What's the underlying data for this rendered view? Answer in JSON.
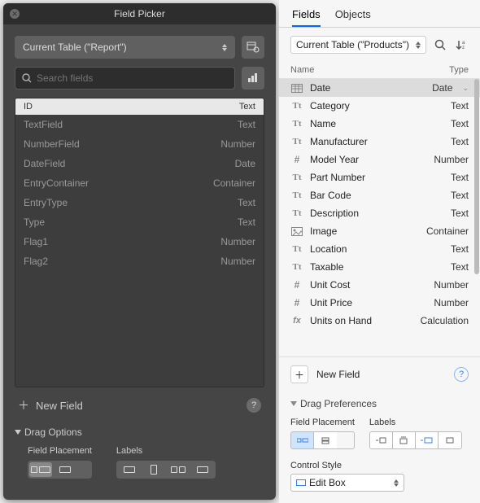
{
  "left": {
    "title": "Field Picker",
    "table_select": "Current Table (\"Report\")",
    "search_placeholder": "Search fields",
    "columns": {
      "name": "ID",
      "type": "Text"
    },
    "fields": [
      {
        "name": "TextField",
        "type": "Text"
      },
      {
        "name": "NumberField",
        "type": "Number"
      },
      {
        "name": "DateField",
        "type": "Date"
      },
      {
        "name": "EntryContainer",
        "type": "Container"
      },
      {
        "name": "EntryType",
        "type": "Text"
      },
      {
        "name": "Type",
        "type": "Text"
      },
      {
        "name": "Flag1",
        "type": "Number"
      },
      {
        "name": "Flag2",
        "type": "Number"
      }
    ],
    "new_field": "New Field",
    "drag_options": "Drag Options",
    "field_placement": "Field Placement",
    "labels": "Labels"
  },
  "right": {
    "tabs": {
      "fields": "Fields",
      "objects": "Objects"
    },
    "table_select": "Current Table (\"Products\")",
    "columns": {
      "name": "Name",
      "type": "Type"
    },
    "fields": [
      {
        "icon": "table",
        "name": "Date",
        "type": "Date",
        "selected": true
      },
      {
        "icon": "Tt",
        "name": "Category",
        "type": "Text"
      },
      {
        "icon": "Tt",
        "name": "Name",
        "type": "Text"
      },
      {
        "icon": "Tt",
        "name": "Manufacturer",
        "type": "Text"
      },
      {
        "icon": "#",
        "name": "Model Year",
        "type": "Number"
      },
      {
        "icon": "Tt",
        "name": "Part Number",
        "type": "Text"
      },
      {
        "icon": "Tt",
        "name": "Bar Code",
        "type": "Text"
      },
      {
        "icon": "Tt",
        "name": "Description",
        "type": "Text"
      },
      {
        "icon": "image",
        "name": "Image",
        "type": "Container"
      },
      {
        "icon": "Tt",
        "name": "Location",
        "type": "Text"
      },
      {
        "icon": "Tt",
        "name": "Taxable",
        "type": "Text"
      },
      {
        "icon": "#",
        "name": "Unit Cost",
        "type": "Number"
      },
      {
        "icon": "#",
        "name": "Unit Price",
        "type": "Number"
      },
      {
        "icon": "fx",
        "name": "Units on Hand",
        "type": "Calculation"
      }
    ],
    "new_field": "New Field",
    "drag_preferences": "Drag Preferences",
    "field_placement": "Field Placement",
    "labels": "Labels",
    "control_style": "Control Style",
    "control_style_value": "Edit Box"
  }
}
